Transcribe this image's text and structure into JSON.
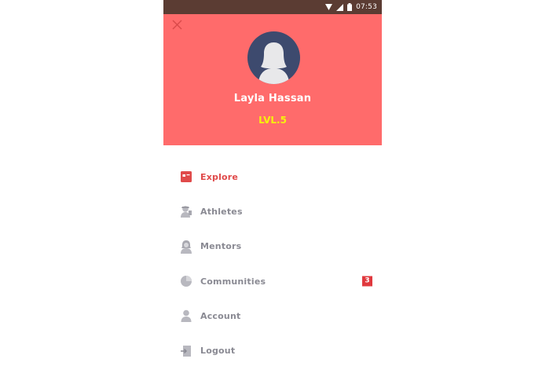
{
  "status_bar": {
    "time": "07:53",
    "icons": [
      "wifi-icon",
      "signal-icon",
      "battery-icon"
    ],
    "background": "#5b3c33"
  },
  "header": {
    "background": "#ff6b6b",
    "close_icon": "close-icon",
    "user_name": "Layla Hassan",
    "level": "LVL.5",
    "level_color": "#f6f20c",
    "avatar_background": "#3d4a6e"
  },
  "menu": {
    "active_color": "#e04a4a",
    "items": [
      {
        "label": "Explore",
        "icon": "explore-icon",
        "active": true
      },
      {
        "label": "Athletes",
        "icon": "athletes-icon",
        "active": false
      },
      {
        "label": "Mentors",
        "icon": "mentors-icon",
        "active": false
      },
      {
        "label": "Communities",
        "icon": "communities-icon",
        "active": false,
        "badge": "3"
      },
      {
        "label": "Account",
        "icon": "account-icon",
        "active": false
      },
      {
        "label": "Logout",
        "icon": "logout-icon",
        "active": false
      }
    ]
  }
}
